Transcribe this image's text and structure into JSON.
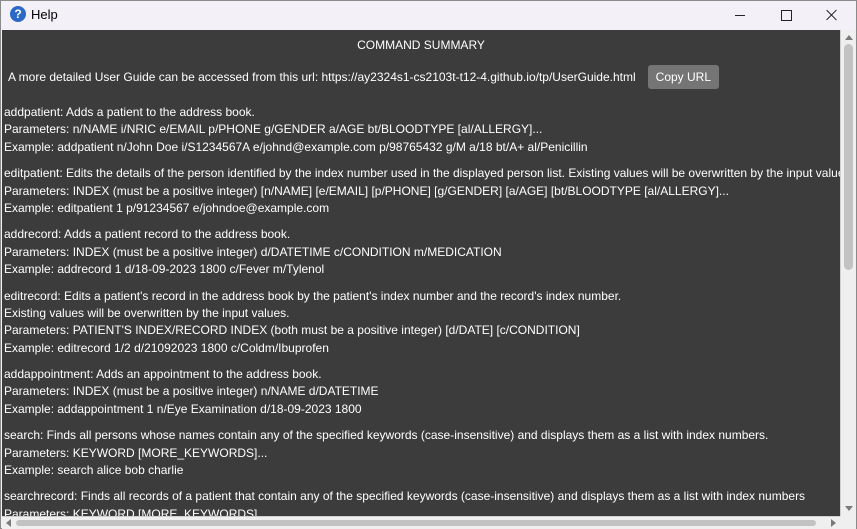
{
  "window": {
    "title": "Help",
    "icon": "help-question-icon"
  },
  "content": {
    "summary_title": "COMMAND SUMMARY",
    "url_text": "A more detailed User Guide can be accessed from this url: https://ay2324s1-cs2103t-t12-4.github.io/tp/UserGuide.html",
    "copy_button": "Copy URL",
    "commands": [
      {
        "lines": [
          "addpatient: Adds a patient to the address book.",
          "Parameters: n/NAME i/NRIC e/EMAIL p/PHONE g/GENDER a/AGE bt/BLOODTYPE [al/ALLERGY]...",
          "Example: addpatient n/John Doe i/S1234567A e/johnd@example.com p/98765432 g/M a/18 bt/A+ al/Penicillin"
        ]
      },
      {
        "lines": [
          "editpatient: Edits the details of the person identified by the index number used in the displayed person list. Existing values will be overwritten by the input values.",
          "Parameters: INDEX (must be a positive integer) [n/NAME] [e/EMAIL] [p/PHONE] [g/GENDER] [a/AGE] [bt/BLOODTYPE [al/ALLERGY]...",
          "Example: editpatient 1 p/91234567 e/johndoe@example.com"
        ]
      },
      {
        "lines": [
          "addrecord: Adds a patient record to the address book.",
          "Parameters: INDEX (must be a positive integer) d/DATETIME c/CONDITION m/MEDICATION",
          "Example: addrecord 1 d/18-09-2023 1800 c/Fever m/Tylenol"
        ]
      },
      {
        "lines": [
          "editrecord: Edits a patient's record in the address book by the patient's index number and the record's index number.",
          "Existing values will be overwritten by the input values.",
          "Parameters: PATIENT'S INDEX/RECORD INDEX (both must be a positive integer) [d/DATE] [c/CONDITION]",
          "Example: editrecord 1/2 d/21092023 1800 c/Coldm/Ibuprofen"
        ]
      },
      {
        "lines": [
          "addappointment: Adds an appointment to the address book.",
          "Parameters: INDEX (must be a positive integer) n/NAME d/DATETIME",
          "Example: addappointment 1 n/Eye Examination d/18-09-2023 1800"
        ]
      },
      {
        "lines": [
          "search: Finds all persons whose names contain any of the specified keywords (case-insensitive) and displays them as a list with index numbers.",
          "Parameters: KEYWORD [MORE_KEYWORDS]...",
          "Example: search alice bob charlie"
        ]
      },
      {
        "lines": [
          "searchrecord: Finds all records of a patient that contain any of the specified keywords (case-insensitive) and displays them as a list with index numbers",
          "Parameters: KEYWORD [MORE_KEYWORDS]..."
        ]
      }
    ]
  },
  "colors": {
    "content_background": "#3c3c3c",
    "text": "#ffffff",
    "button_background": "#757575",
    "titlebar": "#f3f0f7"
  }
}
